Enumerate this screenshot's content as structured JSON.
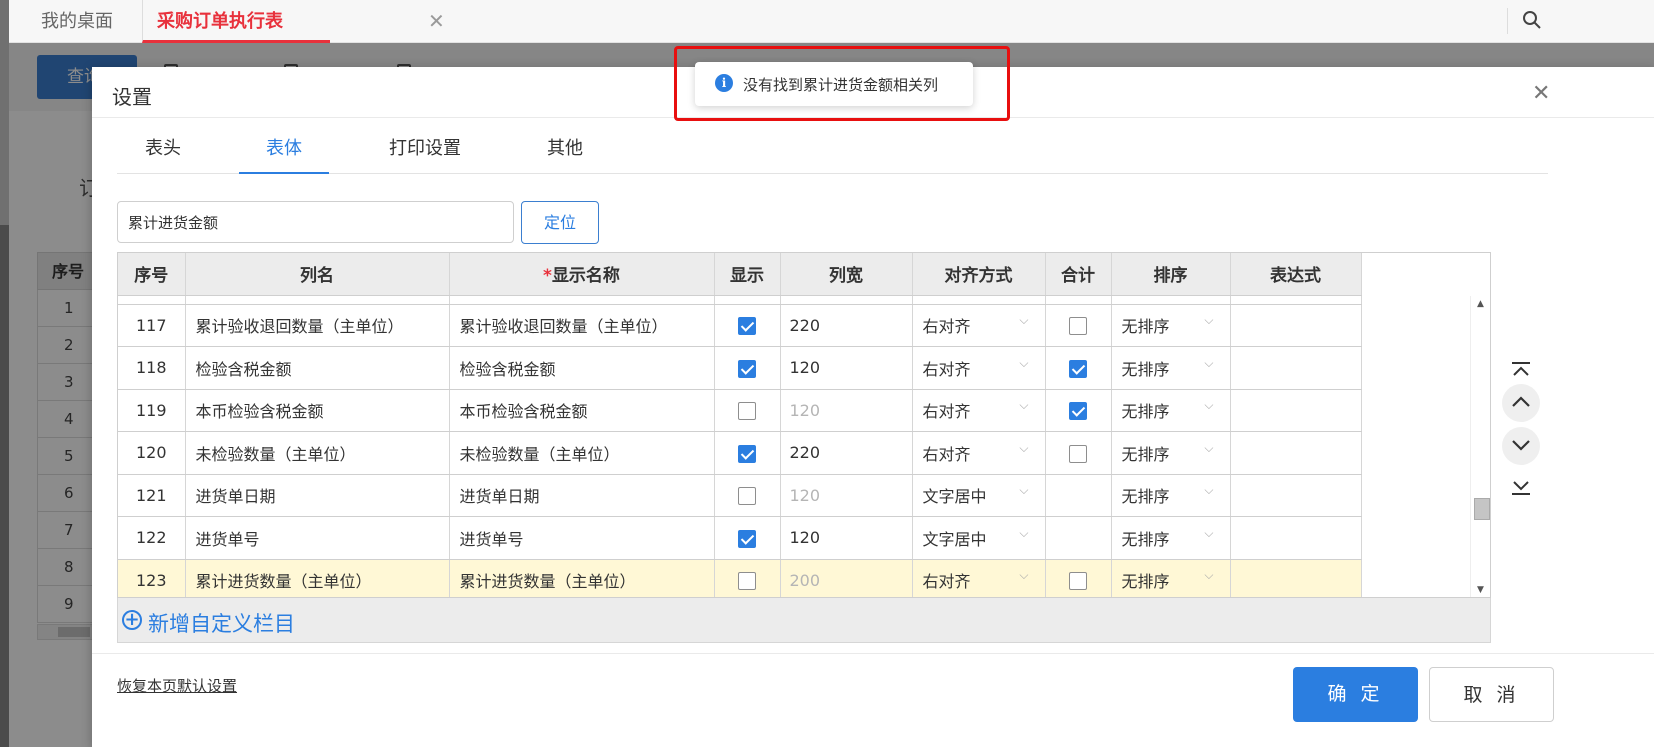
{
  "tabs": {
    "desk": "我的桌面",
    "order": "采购订单执行表",
    "close_glyph": "✕"
  },
  "background": {
    "query_button": "查询",
    "order_label": "订",
    "table_header": "序号",
    "row_numbers": [
      "1",
      "2",
      "3",
      "4",
      "5",
      "6",
      "7",
      "8",
      "9"
    ]
  },
  "modal": {
    "title": "设置",
    "close_glyph": "✕",
    "tabs": [
      "表头",
      "表体",
      "打印设置",
      "其他"
    ],
    "active_tab": "表体",
    "search_value": "累计进货金额",
    "locate_button": "定位",
    "columns": {
      "seq": "序号",
      "name": "列名",
      "required_mark": "*",
      "display": "显示名称",
      "show": "显示",
      "width": "列宽",
      "align": "对齐方式",
      "sum": "合计",
      "sort": "排序",
      "expr": "表达式"
    },
    "rows": [
      {
        "seq": "117",
        "name": "累计验收退回数量（主单位）",
        "display": "累计验收退回数量（主单位）",
        "show": true,
        "width": "220",
        "width_disabled": false,
        "align": "右对齐",
        "sum": false,
        "has_sum": true,
        "sort": "无排序",
        "highlight": false
      },
      {
        "seq": "118",
        "name": "检验含税金额",
        "display": "检验含税金额",
        "show": true,
        "width": "120",
        "width_disabled": false,
        "align": "右对齐",
        "sum": true,
        "has_sum": true,
        "sort": "无排序",
        "highlight": false
      },
      {
        "seq": "119",
        "name": "本币检验含税金额",
        "display": "本币检验含税金额",
        "show": false,
        "width": "120",
        "width_disabled": true,
        "align": "右对齐",
        "sum": true,
        "has_sum": true,
        "sort": "无排序",
        "highlight": false
      },
      {
        "seq": "120",
        "name": "未检验数量（主单位）",
        "display": "未检验数量（主单位）",
        "show": true,
        "width": "220",
        "width_disabled": false,
        "align": "右对齐",
        "sum": false,
        "has_sum": true,
        "sort": "无排序",
        "highlight": false
      },
      {
        "seq": "121",
        "name": "进货单日期",
        "display": "进货单日期",
        "show": false,
        "width": "120",
        "width_disabled": true,
        "align": "文字居中",
        "sum": false,
        "has_sum": false,
        "sort": "无排序",
        "highlight": false
      },
      {
        "seq": "122",
        "name": "进货单号",
        "display": "进货单号",
        "show": true,
        "width": "120",
        "width_disabled": false,
        "align": "文字居中",
        "sum": false,
        "has_sum": false,
        "sort": "无排序",
        "highlight": false
      },
      {
        "seq": "123",
        "name": "累计进货数量（主单位）",
        "display": "累计进货数量（主单位）",
        "show": false,
        "width": "200",
        "width_disabled": true,
        "align": "右对齐",
        "sum": false,
        "has_sum": true,
        "sort": "无排序",
        "highlight": true
      }
    ],
    "add_custom": "新增自定义栏目",
    "restore_defaults": "恢复本页默认设置",
    "ok_button": "确 定",
    "cancel_button": "取 消",
    "side_buttons": [
      "move-top-icon",
      "move-up-icon",
      "move-down-icon",
      "move-bottom-icon"
    ]
  },
  "toast": {
    "message": "没有找到累计进货金额相关列",
    "icon_glyph": "i"
  },
  "colors": {
    "accent": "#2b7ee0",
    "tab_red": "#e8313c",
    "highlight_row": "#fff8d6",
    "annotation_box": "#e80f0f"
  }
}
